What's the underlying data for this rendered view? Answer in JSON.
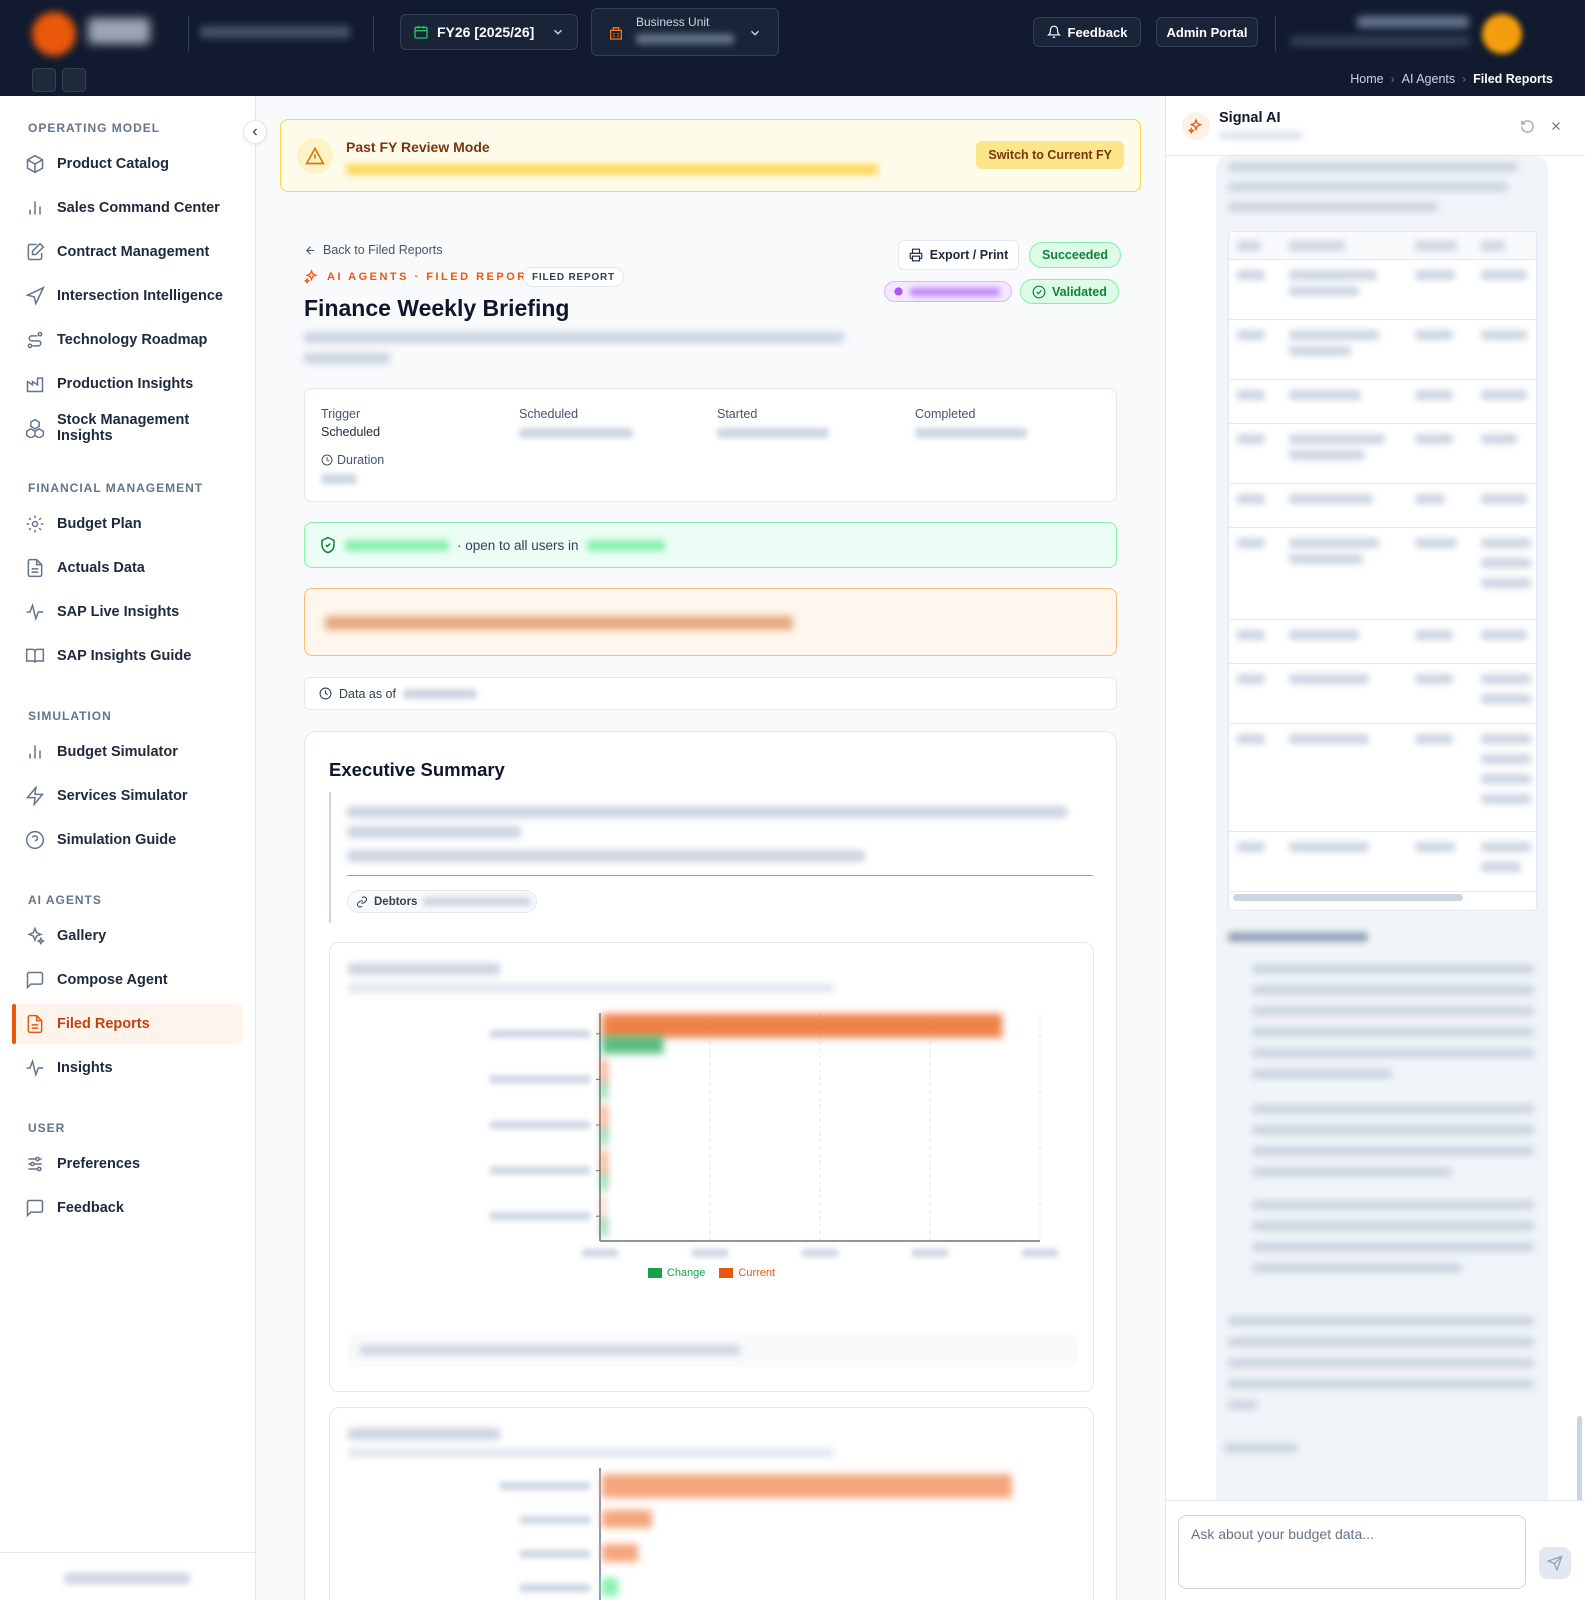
{
  "header": {
    "fiscal_year": "FY26 [2025/26]",
    "business_unit_label": "Business Unit",
    "feedback_label": "Feedback",
    "admin_label": "Admin Portal",
    "breadcrumb": [
      "Home",
      "AI Agents",
      "Filed Reports"
    ]
  },
  "sidebar": {
    "sections": [
      {
        "title": "OPERATING MODEL",
        "items": [
          "Product Catalog",
          "Sales Command Center",
          "Contract Management",
          "Intersection Intelligence",
          "Technology Roadmap",
          "Production Insights",
          "Stock Management Insights"
        ]
      },
      {
        "title": "FINANCIAL MANAGEMENT",
        "items": [
          "Budget Plan",
          "Actuals Data",
          "SAP Live Insights",
          "SAP Insights Guide"
        ]
      },
      {
        "title": "SIMULATION",
        "items": [
          "Budget Simulator",
          "Services Simulator",
          "Simulation Guide"
        ]
      },
      {
        "title": "AI AGENTS",
        "items": [
          "Gallery",
          "Compose Agent",
          "Filed Reports",
          "Insights"
        ]
      },
      {
        "title": "USER",
        "items": [
          "Preferences",
          "Feedback"
        ]
      }
    ],
    "active_item": "Filed Reports"
  },
  "banner": {
    "title": "Past FY Review Mode",
    "button": "Switch to Current FY"
  },
  "report": {
    "back_label": "Back to Filed Reports",
    "kicker": "AI AGENTS · FILED REPORT",
    "tag": "FILED REPORT",
    "title": "Finance Weekly Briefing",
    "export_label": "Export / Print",
    "status": "Succeeded",
    "validated": "Validated",
    "meta": {
      "trigger_label": "Trigger",
      "trigger_value": "Scheduled",
      "scheduled_label": "Scheduled",
      "started_label": "Started",
      "completed_label": "Completed",
      "duration_label": "Duration"
    },
    "access_text": "· open to all users in",
    "data_as_of_label": "Data as of",
    "summary_title": "Executive Summary",
    "debtors_label": "Debtors"
  },
  "chart_data": {
    "type": "bar",
    "orientation": "horizontal",
    "series": [
      {
        "name": "Change",
        "color": "#16a34a",
        "values": [
          0.14,
          0.01,
          0.01,
          0.01,
          0.01
        ]
      },
      {
        "name": "Current",
        "color": "#ea580c",
        "values": [
          0.91,
          0.01,
          0.01,
          0.01,
          0.0
        ]
      }
    ],
    "xlim": [
      0,
      1
    ],
    "grid": true,
    "legend": "bottom"
  },
  "chat": {
    "title": "Signal AI",
    "placeholder": "Ask about your budget data..."
  },
  "colors": {
    "accent": "#ea580c",
    "topbar": "#111a2e",
    "success": "#15803d",
    "warning": "#78350f"
  }
}
